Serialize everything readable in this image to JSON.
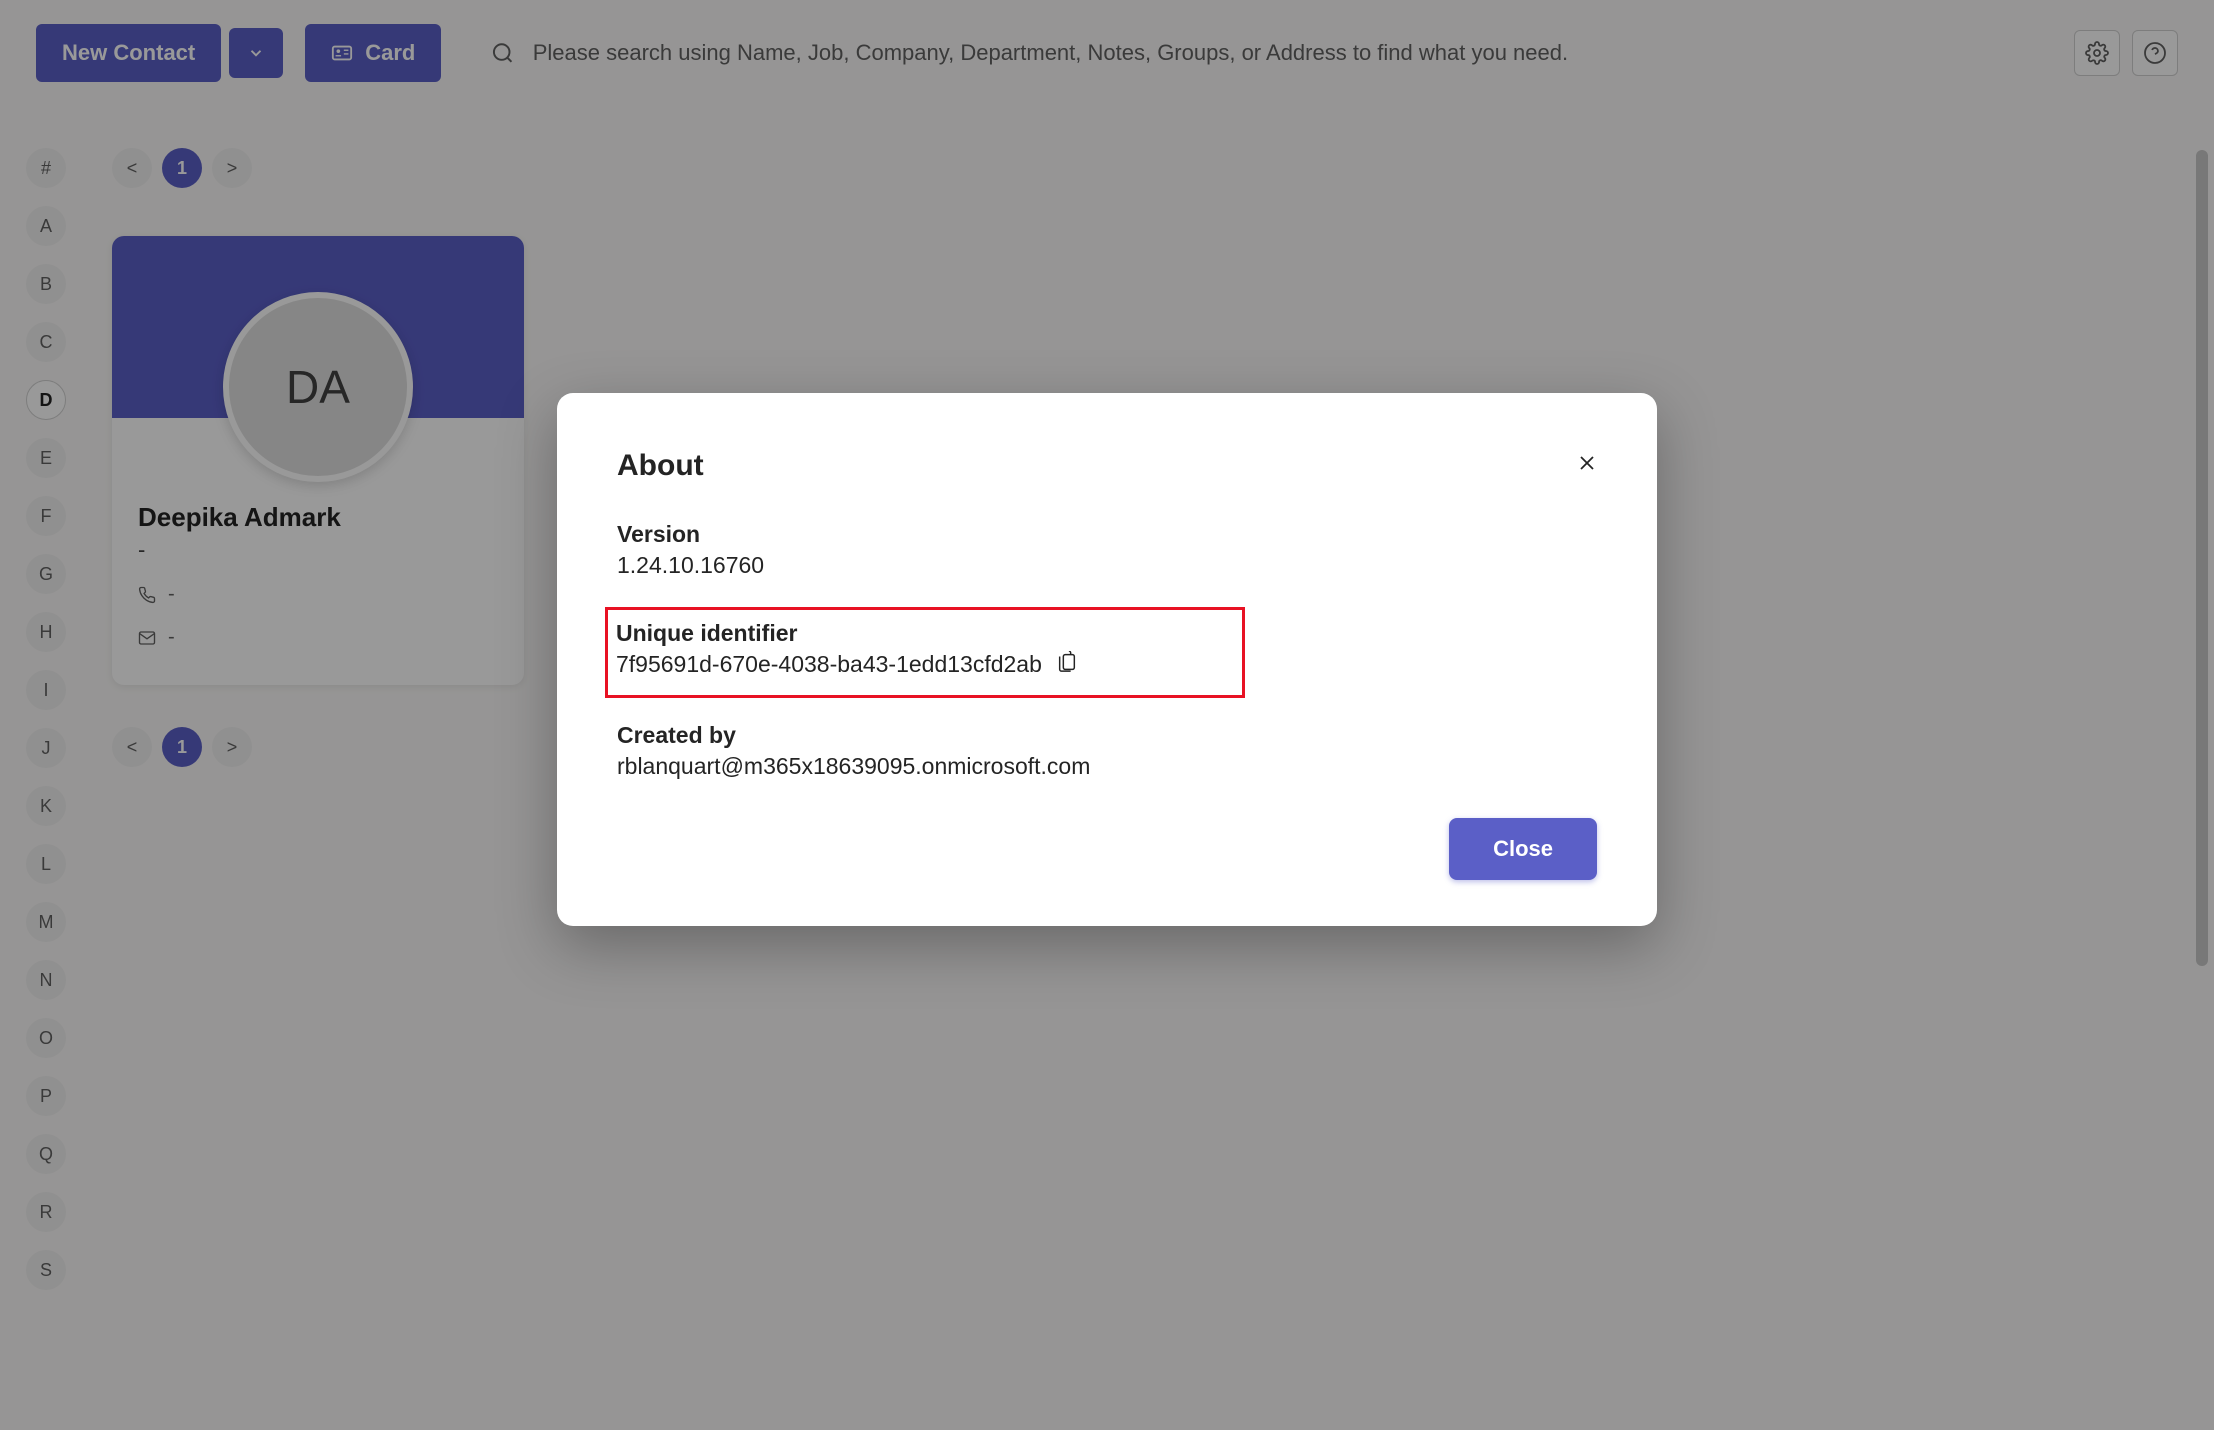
{
  "toolbar": {
    "new_contact_label": "New Contact",
    "card_label": "Card",
    "search_placeholder": "Please search using Name, Job, Company, Department, Notes, Groups, or Address to find what you need."
  },
  "alphabet": [
    "#",
    "A",
    "B",
    "C",
    "D",
    "E",
    "F",
    "G",
    "H",
    "I",
    "J",
    "K",
    "L",
    "M",
    "N",
    "O",
    "P",
    "Q",
    "R",
    "S"
  ],
  "alphabet_active": "D",
  "pagination": {
    "prev": "<",
    "page": "1",
    "next": ">"
  },
  "contact": {
    "initials": "DA",
    "name": "Deepika Admark",
    "subtitle": "-",
    "phone": "-",
    "email": "-"
  },
  "modal": {
    "title": "About",
    "version_label": "Version",
    "version_value": "1.24.10.16760",
    "uid_label": "Unique identifier",
    "uid_value": "7f95691d-670e-4038-ba43-1edd13cfd2ab",
    "created_by_label": "Created by",
    "created_by_value": "rblanquart@m365x18639095.onmicrosoft.com",
    "close_label": "Close"
  }
}
